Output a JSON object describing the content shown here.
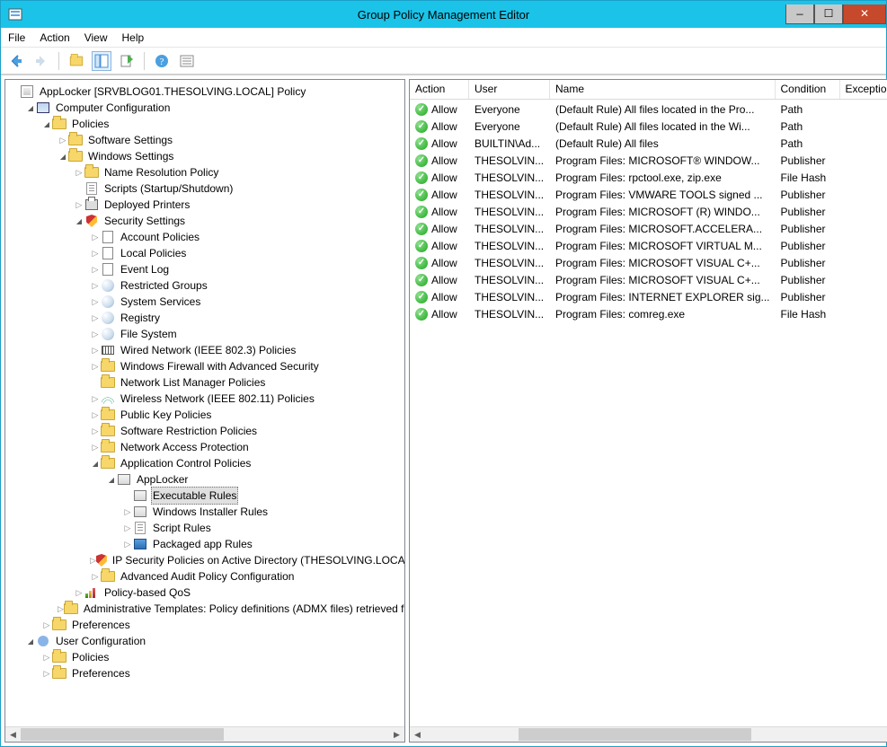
{
  "window": {
    "title": "Group Policy Management Editor",
    "menus": [
      "File",
      "Action",
      "View",
      "Help"
    ]
  },
  "root_label": "AppLocker [SRVBLOG01.THESOLVING.LOCAL] Policy",
  "tree": {
    "computer_configuration": "Computer Configuration",
    "policies": "Policies",
    "software_settings": "Software Settings",
    "windows_settings": "Windows Settings",
    "name_resolution_policy": "Name Resolution Policy",
    "scripts": "Scripts (Startup/Shutdown)",
    "deployed_printers": "Deployed Printers",
    "security_settings": "Security Settings",
    "account_policies": "Account Policies",
    "local_policies": "Local Policies",
    "event_log": "Event Log",
    "restricted_groups": "Restricted Groups",
    "system_services": "System Services",
    "registry": "Registry",
    "file_system": "File System",
    "wired_network": "Wired Network (IEEE 802.3) Policies",
    "windows_firewall": "Windows Firewall with Advanced Security",
    "network_list": "Network List Manager Policies",
    "wireless_network": "Wireless Network (IEEE 802.11) Policies",
    "public_key": "Public Key Policies",
    "software_restriction": "Software Restriction Policies",
    "nap": "Network Access Protection",
    "acp": "Application Control Policies",
    "applocker": "AppLocker",
    "exec_rules": "Executable Rules",
    "installer_rules": "Windows Installer Rules",
    "script_rules": "Script Rules",
    "packaged_rules": "Packaged app Rules",
    "ipsec": "IP Security Policies on Active Directory (THESOLVING.LOCAL",
    "adv_audit": "Advanced Audit Policy Configuration",
    "qos": "Policy-based QoS",
    "admin_templates": "Administrative Templates: Policy definitions (ADMX files) retrieved f",
    "preferences": "Preferences",
    "user_configuration": "User Configuration",
    "user_policies": "Policies",
    "user_preferences": "Preferences"
  },
  "list": {
    "columns": {
      "action": "Action",
      "user": "User",
      "name": "Name",
      "condition": "Condition",
      "exceptions": "Exceptions"
    },
    "rows": [
      {
        "action": "Allow",
        "user": "Everyone",
        "name": "(Default Rule) All files located in the Pro...",
        "condition": "Path"
      },
      {
        "action": "Allow",
        "user": "Everyone",
        "name": "(Default Rule) All files located in the Wi...",
        "condition": "Path"
      },
      {
        "action": "Allow",
        "user": "BUILTIN\\Ad...",
        "name": "(Default Rule) All files",
        "condition": "Path"
      },
      {
        "action": "Allow",
        "user": "THESOLVIN...",
        "name": "Program Files: MICROSOFT® WINDOW...",
        "condition": "Publisher"
      },
      {
        "action": "Allow",
        "user": "THESOLVIN...",
        "name": "Program Files: rpctool.exe, zip.exe",
        "condition": "File Hash"
      },
      {
        "action": "Allow",
        "user": "THESOLVIN...",
        "name": "Program Files: VMWARE TOOLS signed ...",
        "condition": "Publisher"
      },
      {
        "action": "Allow",
        "user": "THESOLVIN...",
        "name": "Program Files: MICROSOFT (R) WINDO...",
        "condition": "Publisher"
      },
      {
        "action": "Allow",
        "user": "THESOLVIN...",
        "name": "Program Files: MICROSOFT.ACCELERA...",
        "condition": "Publisher"
      },
      {
        "action": "Allow",
        "user": "THESOLVIN...",
        "name": "Program Files: MICROSOFT VIRTUAL M...",
        "condition": "Publisher"
      },
      {
        "action": "Allow",
        "user": "THESOLVIN...",
        "name": "Program Files: MICROSOFT VISUAL C+...",
        "condition": "Publisher"
      },
      {
        "action": "Allow",
        "user": "THESOLVIN...",
        "name": "Program Files: MICROSOFT VISUAL C+...",
        "condition": "Publisher"
      },
      {
        "action": "Allow",
        "user": "THESOLVIN...",
        "name": "Program Files: INTERNET EXPLORER sig...",
        "condition": "Publisher"
      },
      {
        "action": "Allow",
        "user": "THESOLVIN...",
        "name": "Program Files: comreg.exe",
        "condition": "File Hash"
      }
    ]
  }
}
